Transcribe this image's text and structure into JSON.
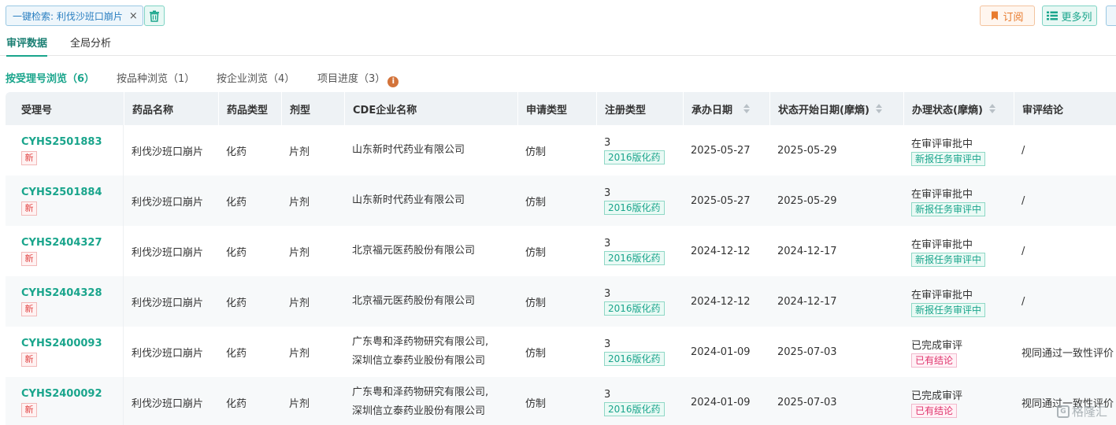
{
  "search_chip": {
    "label": "一键检索: 利伐沙班口崩片",
    "close_glyph": "×"
  },
  "toolbar": {
    "subscribe_label": "订阅",
    "more_columns_label": "更多列"
  },
  "main_tabs": [
    {
      "label": "审评数据",
      "active": true
    },
    {
      "label": "全局分析",
      "active": false
    }
  ],
  "sub_tabs": [
    {
      "label": "按受理号浏览（6）",
      "active": true
    },
    {
      "label": "按品种浏览（1）",
      "active": false
    },
    {
      "label": "按企业浏览（4）",
      "active": false
    },
    {
      "label": "项目进度（3）",
      "active": false
    }
  ],
  "info_glyph": "i",
  "columns": [
    "受理号",
    "药品名称",
    "药品类型",
    "剂型",
    "CDE企业名称",
    "申请类型",
    "注册类型",
    "承办日期",
    "状态开始日期(摩熵)",
    "办理状态(摩熵)",
    "审评结论"
  ],
  "rows": [
    {
      "acc": "CYHS2501883",
      "badge": "新",
      "drug": "利伐沙班口崩片",
      "type": "化药",
      "form": "片剂",
      "company": [
        "山东新时代药业有限公司"
      ],
      "app": "仿制",
      "reg_num": "3",
      "reg_tag": "2016版化药",
      "date": "2025-05-27",
      "status_date": "2025-05-29",
      "status": "在审评审批中",
      "status_tag": "新报任务审评中",
      "status_tag_kind": "green",
      "conclusion": "/"
    },
    {
      "acc": "CYHS2501884",
      "badge": "新",
      "drug": "利伐沙班口崩片",
      "type": "化药",
      "form": "片剂",
      "company": [
        "山东新时代药业有限公司"
      ],
      "app": "仿制",
      "reg_num": "3",
      "reg_tag": "2016版化药",
      "date": "2025-05-27",
      "status_date": "2025-05-29",
      "status": "在审评审批中",
      "status_tag": "新报任务审评中",
      "status_tag_kind": "green",
      "conclusion": "/"
    },
    {
      "acc": "CYHS2404327",
      "badge": "新",
      "drug": "利伐沙班口崩片",
      "type": "化药",
      "form": "片剂",
      "company": [
        "北京福元医药股份有限公司"
      ],
      "app": "仿制",
      "reg_num": "3",
      "reg_tag": "2016版化药",
      "date": "2024-12-12",
      "status_date": "2024-12-17",
      "status": "在审评审批中",
      "status_tag": "新报任务审评中",
      "status_tag_kind": "green",
      "conclusion": "/"
    },
    {
      "acc": "CYHS2404328",
      "badge": "新",
      "drug": "利伐沙班口崩片",
      "type": "化药",
      "form": "片剂",
      "company": [
        "北京福元医药股份有限公司"
      ],
      "app": "仿制",
      "reg_num": "3",
      "reg_tag": "2016版化药",
      "date": "2024-12-12",
      "status_date": "2024-12-17",
      "status": "在审评审批中",
      "status_tag": "新报任务审评中",
      "status_tag_kind": "green",
      "conclusion": "/"
    },
    {
      "acc": "CYHS2400093",
      "badge": "新",
      "drug": "利伐沙班口崩片",
      "type": "化药",
      "form": "片剂",
      "company": [
        "广东粤和泽药物研究有限公司,",
        "深圳信立泰药业股份有限公司"
      ],
      "app": "仿制",
      "reg_num": "3",
      "reg_tag": "2016版化药",
      "date": "2024-01-09",
      "status_date": "2025-07-03",
      "status": "已完成审评",
      "status_tag": "已有结论",
      "status_tag_kind": "red",
      "conclusion": "视同通过一致性评价"
    },
    {
      "acc": "CYHS2400092",
      "badge": "新",
      "drug": "利伐沙班口崩片",
      "type": "化药",
      "form": "片剂",
      "company": [
        "广东粤和泽药物研究有限公司,",
        "深圳信立泰药业股份有限公司"
      ],
      "app": "仿制",
      "reg_num": "3",
      "reg_tag": "2016版化药",
      "date": "2024-01-09",
      "status_date": "2025-07-03",
      "status": "已完成审评",
      "status_tag": "已有结论",
      "status_tag_kind": "red",
      "conclusion": "视同通过一致性评价"
    }
  ],
  "watermark": {
    "mark": "G",
    "text": "格隆汇"
  }
}
